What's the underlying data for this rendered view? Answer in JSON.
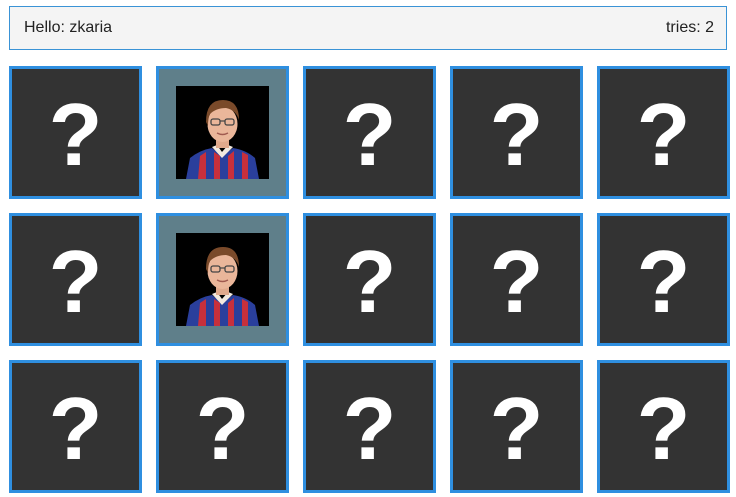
{
  "header": {
    "greeting": "Hello: zkaria",
    "tries": "tries: 2"
  },
  "board": {
    "hidden_symbol": "?",
    "cards": [
      {
        "state": "hidden"
      },
      {
        "state": "revealed",
        "image": "boy-with-glasses-portrait"
      },
      {
        "state": "hidden"
      },
      {
        "state": "hidden"
      },
      {
        "state": "hidden"
      },
      {
        "state": "hidden"
      },
      {
        "state": "revealed",
        "image": "boy-with-glasses-portrait"
      },
      {
        "state": "hidden"
      },
      {
        "state": "hidden"
      },
      {
        "state": "hidden"
      },
      {
        "state": "hidden"
      },
      {
        "state": "hidden"
      },
      {
        "state": "hidden"
      },
      {
        "state": "hidden"
      },
      {
        "state": "hidden"
      }
    ]
  },
  "colors": {
    "card_border": "#2f8fe0",
    "card_back": "#333333",
    "card_revealed": "#5f7f8a",
    "header_border": "#3a93d6",
    "header_bg": "#f4f4f4"
  }
}
